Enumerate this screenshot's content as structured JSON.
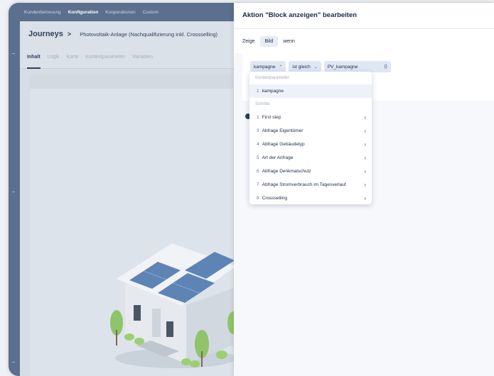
{
  "app": {
    "nav": [
      "Kundenbetreuung",
      "Konfiguration",
      "Kooperationen",
      "Custom"
    ],
    "nav_active_index": 1,
    "breadcrumb": {
      "main": "Journeys",
      "separator": ">",
      "sub": "Photovoltaik-Anlage (Nachqualifizierung inkl. Crossselling)"
    },
    "tabs": [
      "Inhalt",
      "Logik",
      "Karte",
      "Kontextparameter",
      "Variablen"
    ],
    "active_tab": "Inhalt"
  },
  "panel": {
    "title": "Aktion \"Block anzeigen\" bearbeiten",
    "show_label": "Zeige",
    "show_value": "Bild",
    "when_label": "wenn",
    "condition": {
      "parameter": "kampagne",
      "operator": "ist gleich",
      "value": "PV_kampagne",
      "value_icon": "{}"
    }
  },
  "dropdown": {
    "group1_label": "Kontextparameter",
    "group1_items": [
      {
        "num": "1",
        "label": "kampagne"
      }
    ],
    "group2_label": "Schritte",
    "group2_items": [
      {
        "num": "1",
        "label": "First step"
      },
      {
        "num": "3",
        "label": "Abfrage Eigentümer"
      },
      {
        "num": "4",
        "label": "Abfrage Gebäudetyp"
      },
      {
        "num": "5",
        "label": "Art der Anfrage"
      },
      {
        "num": "6",
        "label": "Abfrage Denkmalschutz"
      },
      {
        "num": "7",
        "label": "Abfrage Stromverbrauch im Tagesverlauf"
      },
      {
        "num": "8",
        "label": "Crossselling"
      }
    ]
  },
  "colors": {
    "accent": "#2d3e63",
    "nav_bg": "#5b6f8e",
    "pill_bg": "#dfe6f4"
  },
  "icons": [
    "chevron-down-icon",
    "chevron-right-icon",
    "add-circle-icon"
  ]
}
